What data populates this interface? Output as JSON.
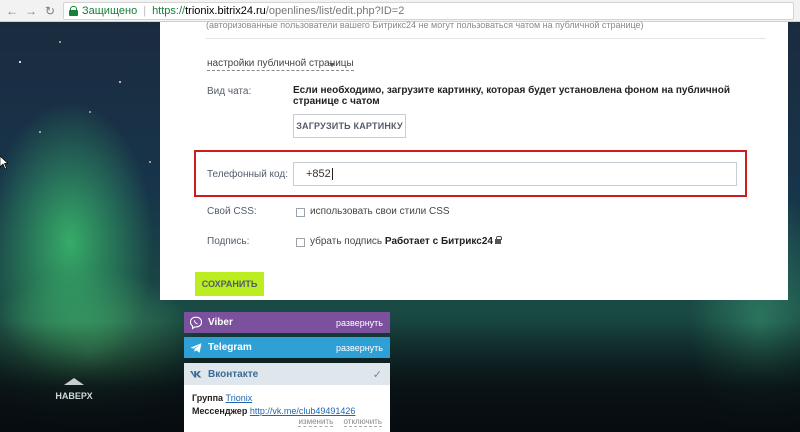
{
  "browser": {
    "secure_label": "Защищено",
    "url_scheme": "https://",
    "url_host": "trionix.bitrix24.ru",
    "url_path": "/openlines/list/edit.php?ID=2"
  },
  "panel": {
    "top_note": "(авторизованные пользователи вашего Битрикс24 не могут пользоваться чатом на публичной странице)",
    "public_settings_link": "настройки публичной страницы",
    "chat_view_label": "Вид чата:",
    "chat_view_hint": "Если необходимо, загрузите картинку, которая будет установлена фоном на публичной странице с чатом",
    "upload_button": "ЗАГРУЗИТЬ КАРТИНКУ",
    "phone_label": "Телефонный код:",
    "phone_value": "+852",
    "css_label": "Свой CSS:",
    "css_option": "использовать свои стили CSS",
    "signature_label": "Подпись:",
    "signature_option_prefix": "убрать подпись",
    "signature_option_bold": "Работает с Битрикс24",
    "save_button": "СОХРАНИТЬ"
  },
  "connectors": {
    "viber": {
      "name": "Viber",
      "action": "развернуть",
      "color": "#7b519d"
    },
    "telegram": {
      "name": "Telegram",
      "action": "развернуть",
      "color": "#2fa0d6"
    },
    "vk": {
      "name": "Вконтакте",
      "group_label": "Группа",
      "group_value": "Trionix",
      "messenger_label": "Мессенджер",
      "messenger_value": "http://vk.me/club49491426",
      "edit_action": "изменить",
      "disable_action": "отключить"
    }
  },
  "page": {
    "scroll_top_label": "НАВЕРХ"
  }
}
